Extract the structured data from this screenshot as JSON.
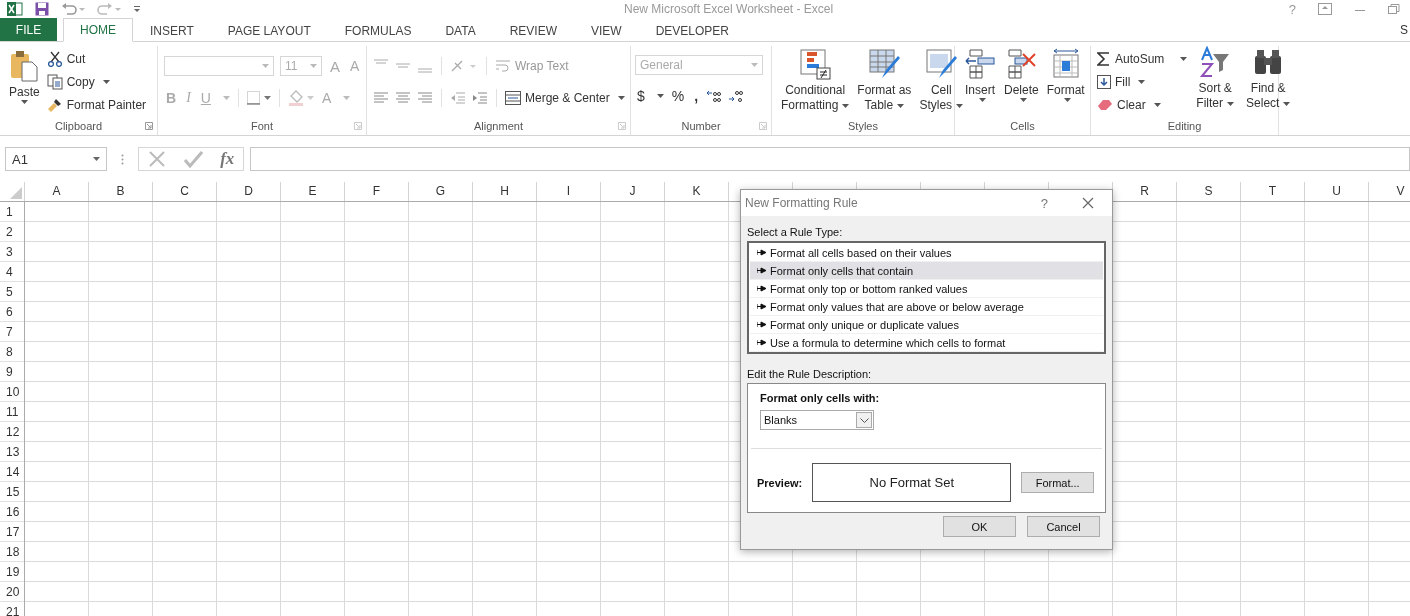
{
  "window": {
    "title": "New Microsoft Excel Worksheet - Excel",
    "help": "?"
  },
  "ribbon_tabs": [
    {
      "label": "FILE",
      "kind": "file",
      "selected": false
    },
    {
      "label": "HOME",
      "kind": "tab",
      "selected": true
    },
    {
      "label": "INSERT",
      "kind": "tab",
      "selected": false
    },
    {
      "label": "PAGE LAYOUT",
      "kind": "tab",
      "selected": false
    },
    {
      "label": "FORMULAS",
      "kind": "tab",
      "selected": false
    },
    {
      "label": "DATA",
      "kind": "tab",
      "selected": false
    },
    {
      "label": "REVIEW",
      "kind": "tab",
      "selected": false
    },
    {
      "label": "VIEW",
      "kind": "tab",
      "selected": false
    },
    {
      "label": "DEVELOPER",
      "kind": "tab",
      "selected": false
    }
  ],
  "account": "S",
  "clipboard": {
    "label": "Clipboard",
    "paste": "Paste",
    "cut": "Cut",
    "copy": "Copy",
    "format_painter": "Format Painter"
  },
  "font": {
    "label": "Font",
    "size": "11",
    "grow": "A",
    "shrink": "A",
    "bold": "B",
    "italic": "I",
    "underline": "U",
    "font_color": "A"
  },
  "alignment": {
    "label": "Alignment",
    "wrap_text": "Wrap Text",
    "merge_center": "Merge & Center"
  },
  "number": {
    "label": "Number",
    "format": "General",
    "currency": "$",
    "percent": "%",
    "comma": ","
  },
  "styles": {
    "label": "Styles",
    "buttons": [
      [
        "Conditional",
        "Formatting"
      ],
      [
        "Format as",
        "Table"
      ],
      [
        "Cell",
        "Styles"
      ]
    ]
  },
  "cells": {
    "label": "Cells",
    "buttons": [
      "Insert",
      "Delete",
      "Format"
    ]
  },
  "editing": {
    "label": "Editing",
    "autosum": "AutoSum",
    "fill": "Fill",
    "clear": "Clear",
    "sort_filter": [
      "Sort &",
      "Filter"
    ],
    "find_select": [
      "Find &",
      "Select"
    ]
  },
  "formula_bar": {
    "name_box": "A1",
    "fx": "fx"
  },
  "sheet": {
    "columns_left": [
      "A",
      "B",
      "C",
      "D",
      "E",
      "F",
      "G",
      "H",
      "I",
      "J",
      "K"
    ],
    "columns_right": [
      "R",
      "S",
      "T",
      "U",
      "V"
    ],
    "rows": [
      "1",
      "2",
      "3",
      "4",
      "5",
      "6",
      "7",
      "8",
      "9",
      "10",
      "11",
      "12",
      "13",
      "14",
      "15",
      "16",
      "17",
      "18",
      "19",
      "20",
      "21"
    ]
  },
  "dialog": {
    "title": "New Formatting Rule",
    "help": "?",
    "rule_type_label": "Select a Rule Type:",
    "rule_types": [
      {
        "label": "Format all cells based on their values",
        "selected": false
      },
      {
        "label": "Format only cells that contain",
        "selected": true
      },
      {
        "label": "Format only top or bottom ranked values",
        "selected": false
      },
      {
        "label": "Format only values that are above or below average",
        "selected": false
      },
      {
        "label": "Format only unique or duplicate values",
        "selected": false
      },
      {
        "label": "Use a formula to determine which cells to format",
        "selected": false
      }
    ],
    "description_label": "Edit the Rule Description:",
    "cells_with_label": "Format only cells with:",
    "cells_with_value": "Blanks",
    "preview_label": "Preview:",
    "preview_text": "No Format Set",
    "format_button": "Format...",
    "buttons": [
      "OK",
      "Cancel"
    ]
  }
}
